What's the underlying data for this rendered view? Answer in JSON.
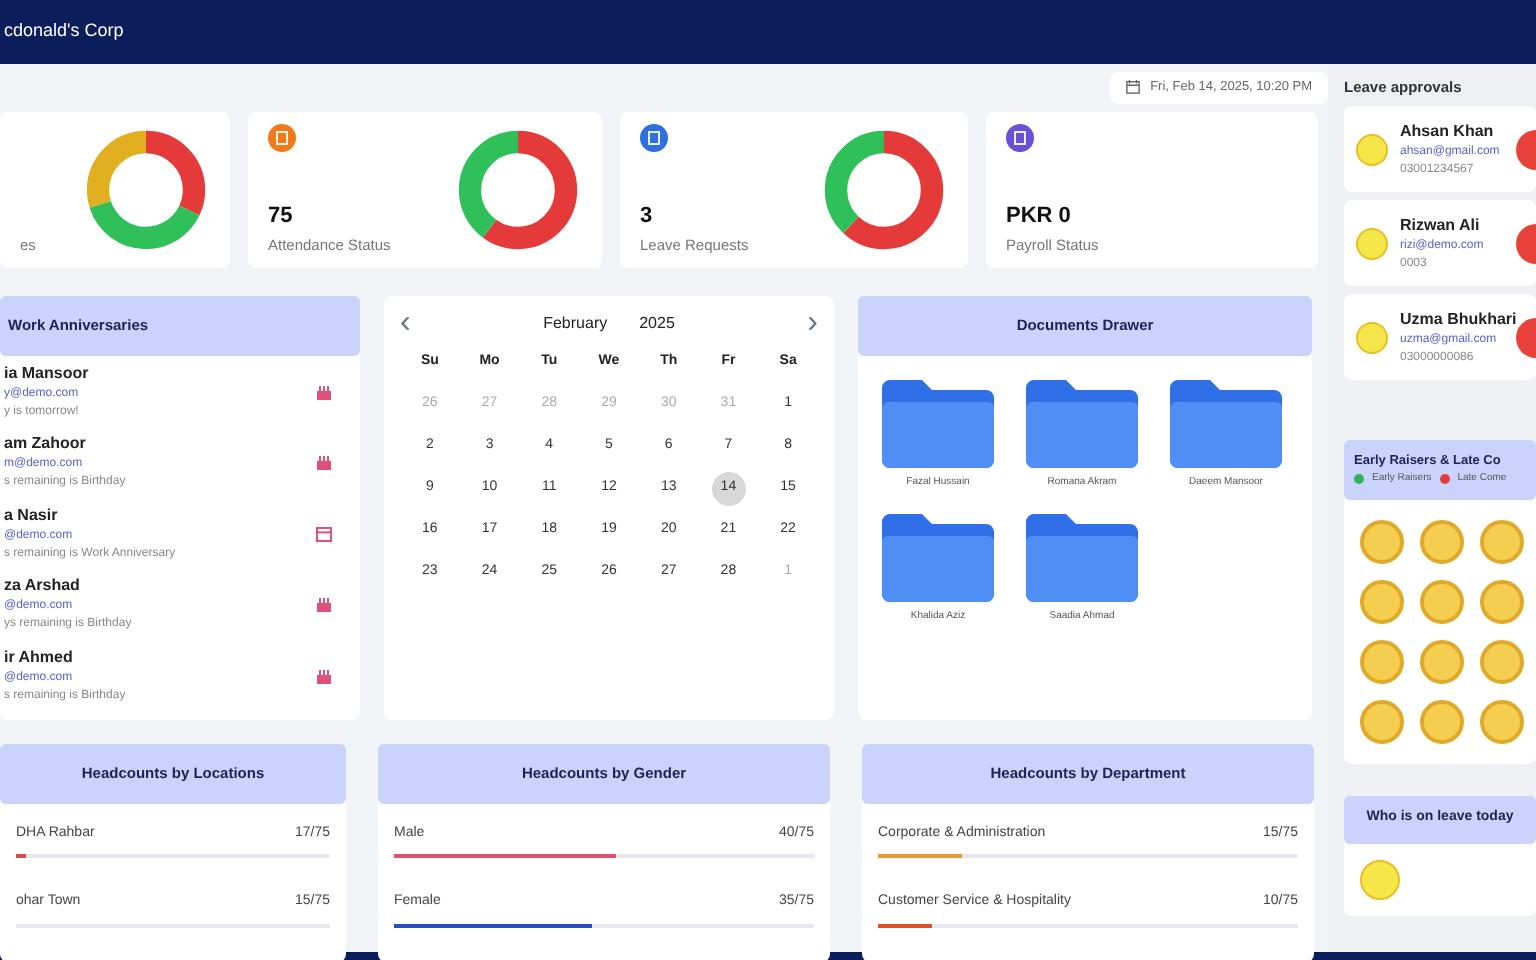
{
  "topbar": {
    "title": "cdonald's Corp"
  },
  "date": "Fri, Feb 14, 2025, 10:20 PM",
  "stats": [
    {
      "label": "es",
      "donut": true
    },
    {
      "value": "75",
      "label": "Attendance Status",
      "color": "#f07a1a",
      "donut": true
    },
    {
      "value": "3",
      "label": "Leave Requests",
      "color": "#2f6fe0",
      "donut": true
    },
    {
      "value": "PKR 0",
      "label": "Payroll Status",
      "color": "#6a4fd8",
      "donut": false
    }
  ],
  "anniversaries": {
    "title": "Work Anniversaries",
    "items": [
      {
        "name": "ia Mansoor",
        "email": "y@demo.com",
        "note": "y is tomorrow!",
        "kind": "birthday"
      },
      {
        "name": "am Zahoor",
        "email": "m@demo.com",
        "note": "s remaining is Birthday",
        "kind": "birthday"
      },
      {
        "name": "a Nasir",
        "email": "@demo.com",
        "note": "s remaining is Work Anniversary",
        "kind": "anniversary"
      },
      {
        "name": "za Arshad",
        "email": "@demo.com",
        "note": "ys remaining is Birthday",
        "kind": "birthday"
      },
      {
        "name": "ir Ahmed",
        "email": "@demo.com",
        "note": "s remaining is Birthday",
        "kind": "birthday"
      }
    ]
  },
  "calendar": {
    "prev": "‹",
    "month": "February",
    "year": "2025",
    "next": "›",
    "weekdays": [
      "Su",
      "Mo",
      "Tu",
      "We",
      "Th",
      "Fr",
      "Sa"
    ],
    "days": [
      {
        "label": "26",
        "muted": true,
        "selected": false
      },
      {
        "label": "27",
        "muted": true,
        "selected": false
      },
      {
        "label": "28",
        "muted": true,
        "selected": false
      },
      {
        "label": "29",
        "muted": true,
        "selected": false
      },
      {
        "label": "30",
        "muted": true,
        "selected": false
      },
      {
        "label": "31",
        "muted": true,
        "selected": false
      },
      {
        "label": "1",
        "muted": false,
        "selected": false
      },
      {
        "label": "2",
        "muted": false,
        "selected": false
      },
      {
        "label": "3",
        "muted": false,
        "selected": false
      },
      {
        "label": "4",
        "muted": false,
        "selected": false
      },
      {
        "label": "5",
        "muted": false,
        "selected": false
      },
      {
        "label": "6",
        "muted": false,
        "selected": false
      },
      {
        "label": "7",
        "muted": false,
        "selected": false
      },
      {
        "label": "8",
        "muted": false,
        "selected": false
      },
      {
        "label": "9",
        "muted": false,
        "selected": false
      },
      {
        "label": "10",
        "muted": false,
        "selected": false
      },
      {
        "label": "11",
        "muted": false,
        "selected": false
      },
      {
        "label": "12",
        "muted": false,
        "selected": false
      },
      {
        "label": "13",
        "muted": false,
        "selected": false
      },
      {
        "label": "14",
        "muted": false,
        "selected": true
      },
      {
        "label": "15",
        "muted": false,
        "selected": false
      },
      {
        "label": "16",
        "muted": false,
        "selected": false
      },
      {
        "label": "17",
        "muted": false,
        "selected": false
      },
      {
        "label": "18",
        "muted": false,
        "selected": false
      },
      {
        "label": "19",
        "muted": false,
        "selected": false
      },
      {
        "label": "20",
        "muted": false,
        "selected": false
      },
      {
        "label": "21",
        "muted": false,
        "selected": false
      },
      {
        "label": "22",
        "muted": false,
        "selected": false
      },
      {
        "label": "23",
        "muted": false,
        "selected": false
      },
      {
        "label": "24",
        "muted": false,
        "selected": false
      },
      {
        "label": "25",
        "muted": false,
        "selected": false
      },
      {
        "label": "26",
        "muted": false,
        "selected": false
      },
      {
        "label": "27",
        "muted": false,
        "selected": false
      },
      {
        "label": "28",
        "muted": false,
        "selected": false
      },
      {
        "label": "1",
        "muted": true,
        "selected": false
      }
    ]
  },
  "documents": {
    "title": "Documents Drawer",
    "folders": [
      "Fazal Hussain",
      "Romana Akram",
      "Daeem Mansoor",
      "Khalida Aziz",
      "Saadia Ahmad"
    ]
  },
  "headcounts": [
    {
      "title": "Headcounts by Locations",
      "rows": [
        {
          "label": "DHA Rahbar",
          "count": "17/75",
          "level": 0.03,
          "color": "#e04848"
        },
        {
          "label": "ohar Town",
          "count": "15/75"
        }
      ]
    },
    {
      "title": "Headcounts by Gender",
      "rows": [
        {
          "label": "Male",
          "count": "40/75",
          "level": 0.53,
          "color": "#e0506a"
        },
        {
          "label": "Female",
          "count": "35/75",
          "level": 0.47,
          "color": "#2a4fc0"
        }
      ]
    },
    {
      "title": "Headcounts by Department",
      "rows": [
        {
          "label": "Corporate & Administration",
          "count": "15/75",
          "level": 0.2,
          "color": "#e89a30"
        },
        {
          "label": "Customer Service & Hospitality",
          "count": "10/75",
          "level": 0.13,
          "color": "#e0502a"
        }
      ]
    }
  ],
  "leave_approvals": {
    "title": "Leave approvals",
    "items": [
      {
        "name": "Ahsan Khan",
        "email": "ahsan@gmail.com",
        "phone": "03001234567"
      },
      {
        "name": "Rizwan Ali",
        "email": "rizi@demo.com",
        "phone": "0003"
      },
      {
        "name": "Uzma Bhukhari",
        "email": "uzma@gmail.com",
        "phone": "03000000086"
      }
    ]
  },
  "early_raisers": {
    "title": "Early Raisers & Late Co",
    "legend": [
      {
        "label": "Early Raisers",
        "color": "#2fb35a"
      },
      {
        "label": "Late Come",
        "color": "#e53a3a"
      }
    ]
  },
  "on_leave": {
    "title": "Who is on leave today"
  }
}
